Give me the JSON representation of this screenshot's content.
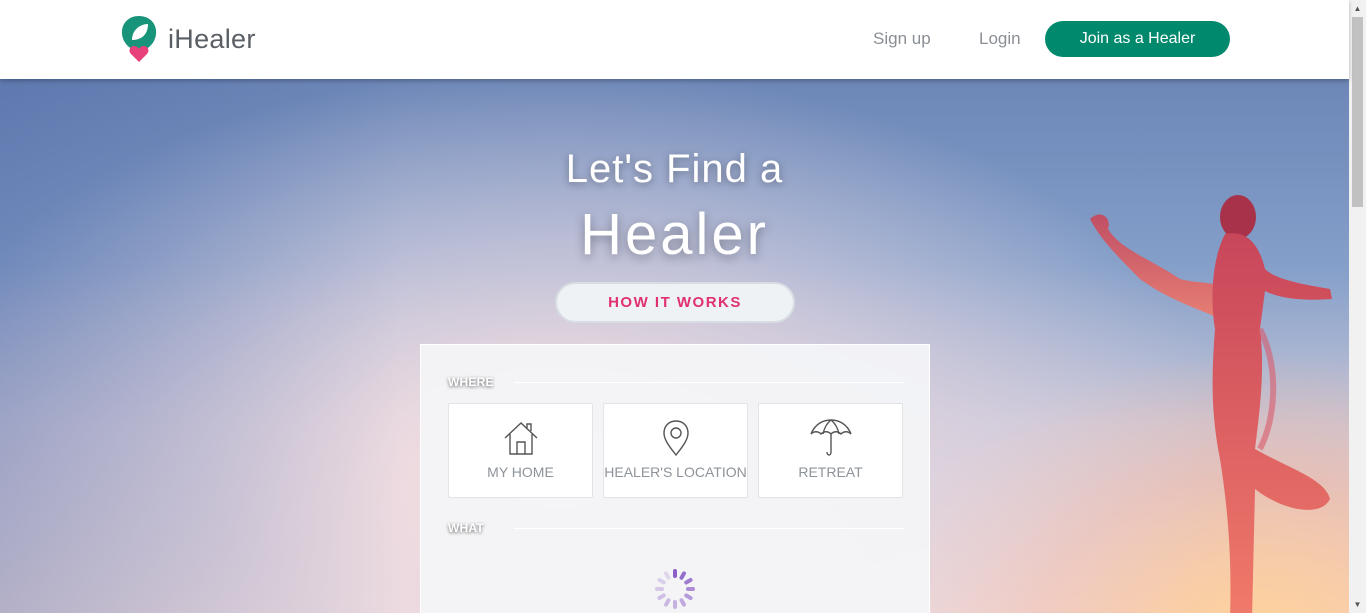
{
  "brand": {
    "name": "iHealer",
    "accent": "#00896c",
    "logo_leaf_color": "#17947a",
    "logo_heart_color": "#e8407a"
  },
  "nav": {
    "signup": "Sign up",
    "login": "Login",
    "join": "Join as a Healer"
  },
  "hero": {
    "headline_line1": "Let's Find a",
    "headline_line2": "Healer",
    "how_it_works": "HOW IT WORKS"
  },
  "search": {
    "where_label": "WHERE",
    "what_label": "WHAT",
    "options": [
      {
        "label": "MY HOME",
        "icon": "house-icon"
      },
      {
        "label": "HEALER'S LOCATION",
        "icon": "map-pin-icon"
      },
      {
        "label": "RETREAT",
        "icon": "umbrella-icon"
      }
    ],
    "loading": true,
    "spinner_color": "#8b5fc7"
  },
  "colors": {
    "how_it_works_text": "#e0306f",
    "nav_link": "#8a8f96"
  }
}
